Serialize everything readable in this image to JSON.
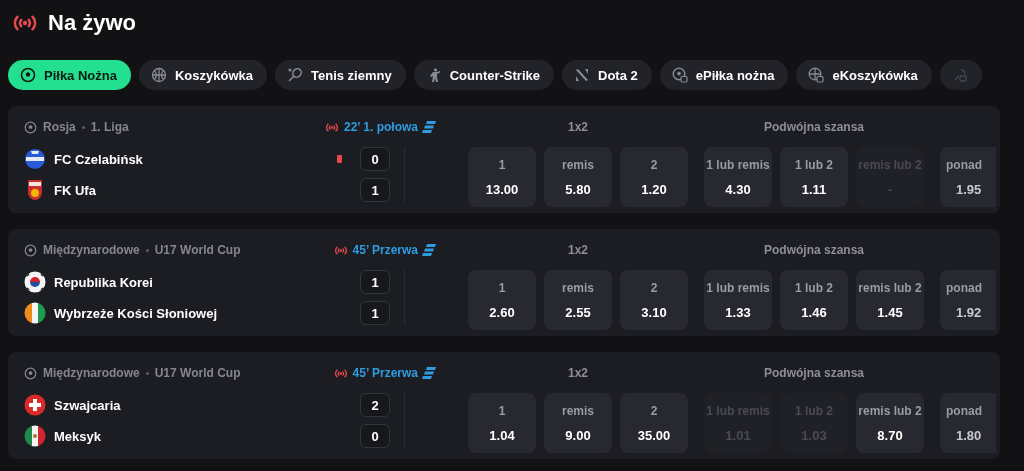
{
  "header": {
    "title": "Na żywo"
  },
  "sport_tabs": [
    {
      "label": "Piłka Nożna",
      "kind": "football",
      "selected": true
    },
    {
      "label": "Koszykówka",
      "kind": "basketball",
      "selected": false
    },
    {
      "label": "Tenis ziemny",
      "kind": "tennis",
      "selected": false
    },
    {
      "label": "Counter-Strike",
      "kind": "shooter",
      "selected": false
    },
    {
      "label": "Dota 2",
      "kind": "dota",
      "selected": false
    },
    {
      "label": "ePiłka nożna",
      "kind": "efootball",
      "selected": false
    },
    {
      "label": "eKoszykówka",
      "kind": "ebasketball",
      "selected": false
    },
    {
      "kind": "esport",
      "selected": false
    }
  ],
  "matches": [
    {
      "country": "Rosja",
      "league": "1. Liga",
      "status": "22’ 1. połowa",
      "teams": [
        {
          "name": "FC Czelabińsk",
          "kind": "club-blue",
          "score": "0",
          "red_card": true
        },
        {
          "name": "FK Ufa",
          "kind": "club-shield",
          "score": "1",
          "red_card": false
        }
      ],
      "markets": [
        {
          "title": "1x2",
          "odds": [
            {
              "label": "1",
              "value": "13.00",
              "disabled": false
            },
            {
              "label": "remis",
              "value": "5.80",
              "disabled": false
            },
            {
              "label": "2",
              "value": "1.20",
              "disabled": false
            }
          ]
        },
        {
          "title": "Podwójna szansa",
          "odds": [
            {
              "label": "1 lub remis",
              "value": "4.30",
              "disabled": false
            },
            {
              "label": "1 lub 2",
              "value": "1.11",
              "disabled": false
            },
            {
              "label": "remis lub 2",
              "value": "-",
              "disabled": true
            }
          ]
        },
        {
          "odds": [
            {
              "label": "ponad",
              "value": "1.95",
              "disabled": false
            }
          ]
        }
      ]
    },
    {
      "country": "Międzynarodowe",
      "league": "U17 World Cup",
      "status": "45’ Przerwa",
      "teams": [
        {
          "name": "Republika Korei",
          "kind": "flag-korea",
          "score": "1",
          "red_card": false
        },
        {
          "name": "Wybrzeże Kości Słoniowej",
          "kind": "flag-ivory",
          "score": "1",
          "red_card": false
        }
      ],
      "markets": [
        {
          "title": "1x2",
          "odds": [
            {
              "label": "1",
              "value": "2.60",
              "disabled": false
            },
            {
              "label": "remis",
              "value": "2.55",
              "disabled": false
            },
            {
              "label": "2",
              "value": "3.10",
              "disabled": false
            }
          ]
        },
        {
          "title": "Podwójna szansa",
          "odds": [
            {
              "label": "1 lub remis",
              "value": "1.33",
              "disabled": false
            },
            {
              "label": "1 lub 2",
              "value": "1.46",
              "disabled": false
            },
            {
              "label": "remis lub 2",
              "value": "1.45",
              "disabled": false
            }
          ]
        },
        {
          "odds": [
            {
              "label": "ponad",
              "value": "1.92",
              "disabled": false
            }
          ]
        }
      ]
    },
    {
      "country": "Międzynarodowe",
      "league": "U17 World Cup",
      "status": "45’ Przerwa",
      "teams": [
        {
          "name": "Szwajcaria",
          "kind": "flag-swiss",
          "score": "2",
          "red_card": false
        },
        {
          "name": "Meksyk",
          "kind": "flag-mexico",
          "score": "0",
          "red_card": false
        }
      ],
      "markets": [
        {
          "title": "1x2",
          "odds": [
            {
              "label": "1",
              "value": "1.04",
              "disabled": false
            },
            {
              "label": "remis",
              "value": "9.00",
              "disabled": false
            },
            {
              "label": "2",
              "value": "35.00",
              "disabled": false
            }
          ]
        },
        {
          "title": "Podwójna szansa",
          "odds": [
            {
              "label": "1 lub remis",
              "value": "1.01",
              "disabled": true
            },
            {
              "label": "1 lub 2",
              "value": "1.03",
              "disabled": true
            },
            {
              "label": "remis lub 2",
              "value": "8.70",
              "disabled": false
            }
          ]
        },
        {
          "odds": [
            {
              "label": "ponad",
              "value": "1.80",
              "disabled": false
            }
          ]
        }
      ]
    }
  ]
}
